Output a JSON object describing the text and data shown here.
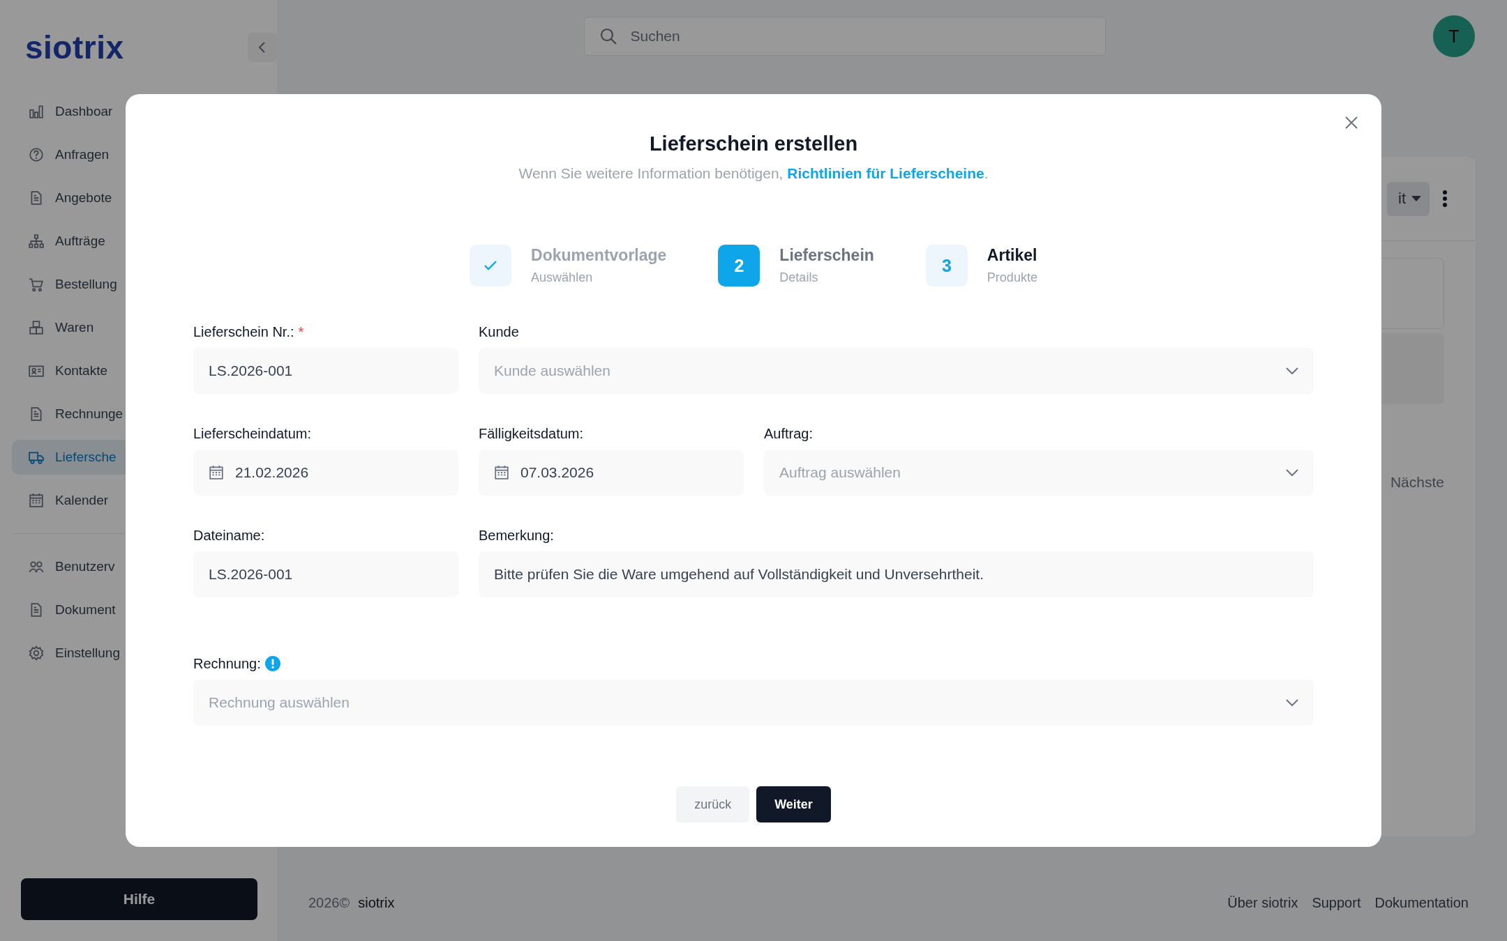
{
  "app": {
    "logo": "siotrix",
    "search": {
      "placeholder": "Suchen"
    },
    "avatar": "T"
  },
  "sidebar": {
    "items": [
      {
        "label": "Dashboar",
        "selected": false
      },
      {
        "label": "Anfragen",
        "selected": false
      },
      {
        "label": "Angebote",
        "selected": false
      },
      {
        "label": "Aufträge",
        "selected": false
      },
      {
        "label": "Bestellung",
        "selected": false
      },
      {
        "label": "Waren",
        "selected": false
      },
      {
        "label": "Kontakte",
        "selected": false
      },
      {
        "label": "Rechnunge",
        "selected": false
      },
      {
        "label": "Liefersche",
        "selected": true
      },
      {
        "label": "Kalender",
        "selected": false
      }
    ],
    "admin_items": [
      {
        "label": "Benutzerv",
        "selected": false
      },
      {
        "label": "Dokument",
        "selected": false
      },
      {
        "label": "Einstellung",
        "selected": false
      }
    ],
    "help_button": "Hilfe"
  },
  "background": {
    "toolbar_button": "it",
    "pager_next": "Nächste"
  },
  "footer": {
    "copyright": "2026©",
    "brand": "siotrix",
    "links": [
      "Über siotrix",
      "Support",
      "Dokumentation"
    ]
  },
  "modal": {
    "title": "Lieferschein erstellen",
    "subtitle": "Wenn Sie weitere Information benötigen, ",
    "subtitle_link": "Richtlinien für Lieferscheine",
    "subtitle_end": ".",
    "steps": [
      {
        "completed": true,
        "selected": false,
        "title": "Dokumentvorlage",
        "subtitle": "Auswählen"
      },
      {
        "completed": false,
        "selected": true,
        "number": "2",
        "title": "Lieferschein",
        "subtitle": "Details"
      },
      {
        "completed": false,
        "selected": false,
        "number": "3",
        "title": "Artikel",
        "subtitle": "Produkte"
      }
    ],
    "rows": [
      [
        {
          "kind": "text",
          "label": "Lieferschein Nr.:",
          "required_mark": "*",
          "value": "LS.2026-001"
        },
        {
          "kind": "select",
          "label": "Kunde",
          "placeholder": "Kunde auswählen"
        }
      ],
      [
        {
          "kind": "date",
          "label": "Lieferscheindatum:",
          "value": "21.02.2026"
        },
        {
          "kind": "date",
          "label": "Fälligkeitsdatum:",
          "value": "07.03.2026"
        },
        {
          "kind": "select",
          "label": "Auftrag:",
          "placeholder": "Auftrag auswählen"
        }
      ],
      [
        {
          "kind": "text",
          "label": "Dateiname:",
          "value": "LS.2026-001"
        },
        {
          "kind": "text",
          "label": "Bemerkung:",
          "value": "Bitte prüfen Sie die Ware umgehend auf Vollständigkeit und Unversehrtheit."
        }
      ]
    ],
    "invoice": {
      "kind": "select",
      "label": "Rechnung:",
      "info": true,
      "placeholder": "Rechnung auswählen"
    },
    "buttons": {
      "back": "zurück",
      "next": "Weiter"
    }
  }
}
